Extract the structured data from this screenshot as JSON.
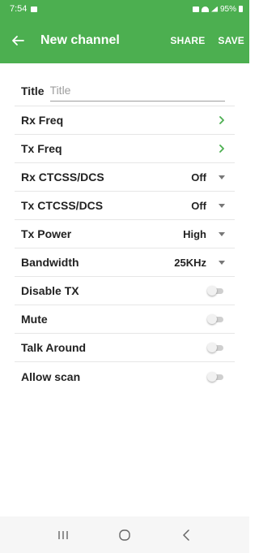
{
  "status_bar": {
    "time": "7:54",
    "battery": "95%"
  },
  "app_bar": {
    "title": "New channel",
    "share_label": "SHARE",
    "save_label": "SAVE",
    "back_icon": "arrow-left-icon"
  },
  "colors": {
    "primary": "#4caf50",
    "chevron": "#4caf50",
    "divider": "#e6e6e6"
  },
  "form": {
    "title_label": "Title",
    "title_placeholder": "Title",
    "title_value": "",
    "rows": [
      {
        "label": "Rx Freq",
        "kind": "link"
      },
      {
        "label": "Tx Freq",
        "kind": "link"
      },
      {
        "label": "Rx CTCSS/DCS",
        "kind": "select",
        "value": "Off"
      },
      {
        "label": "Tx CTCSS/DCS",
        "kind": "select",
        "value": "Off"
      },
      {
        "label": "Tx Power",
        "kind": "select",
        "value": "High"
      },
      {
        "label": "Bandwidth",
        "kind": "select",
        "value": "25KHz"
      },
      {
        "label": "Disable TX",
        "kind": "switch",
        "checked": false
      },
      {
        "label": "Mute",
        "kind": "switch",
        "checked": false
      },
      {
        "label": "Talk Around",
        "kind": "switch",
        "checked": false
      },
      {
        "label": "Allow scan",
        "kind": "switch",
        "checked": false
      }
    ]
  },
  "nav_bar": {
    "recents_icon": "recents-icon",
    "home_icon": "home-icon",
    "back_icon": "back-nav-icon"
  }
}
